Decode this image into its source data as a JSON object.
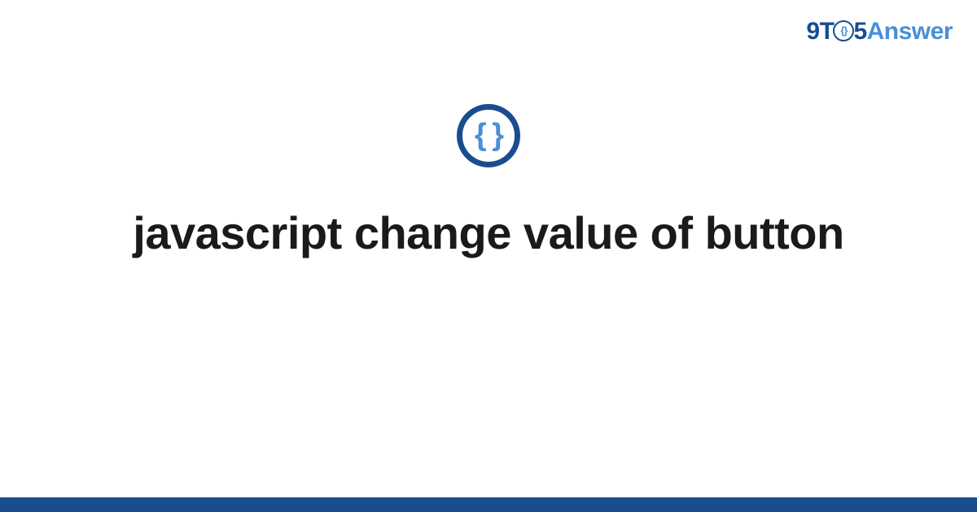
{
  "logo": {
    "part_9t": "9T",
    "part_braces": "{}",
    "part_5": "5",
    "part_answer": "Answer"
  },
  "icon": {
    "braces": "{ }"
  },
  "title": "javascript change value of button",
  "colors": {
    "dark_blue": "#1a4d8f",
    "light_blue": "#4a8fd6",
    "text": "#1a1a1a"
  }
}
